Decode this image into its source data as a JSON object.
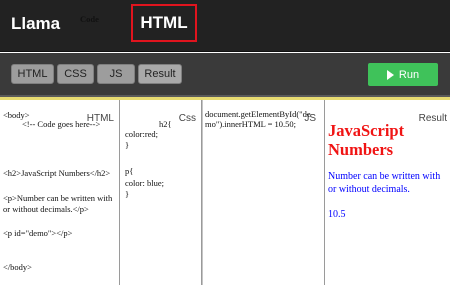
{
  "nav": {
    "items": [
      "Llama",
      "Code",
      "HTML"
    ],
    "active": "HTML"
  },
  "toolbar": {
    "tabs": [
      "HTML",
      "CSS",
      "JS",
      "Result"
    ],
    "run_label": "Run",
    "run_icon": "play-icon"
  },
  "panes": {
    "html": {
      "label": "HTML",
      "lines": [
        "<body>",
        "<!-- Code goes here-->",
        "<h2>JavaScript Numbers</h2>",
        "<p>Number can be written with",
        "or without decimals.</p>",
        "<p id=\"demo\"></p>",
        "</body>"
      ]
    },
    "css": {
      "label": "Css",
      "lines": [
        "h2{",
        "color:red;",
        "}",
        "p{",
        "color: blue;",
        "}"
      ]
    },
    "js": {
      "label": "JS",
      "lines": [
        "document.getElementById(\"de",
        "mo\").innerHTML = 10.50;"
      ]
    },
    "result": {
      "label": "Result",
      "heading": "JavaScript Numbers",
      "paragraph": "Number can be written with or without decimals.",
      "demo_output": "10.5"
    }
  },
  "colors": {
    "topbar": "#222222",
    "toolbar": "#3a3a3a",
    "active_outline": "#e0141e",
    "run_button": "#3fc25a",
    "pane_top_border": "#e7db71",
    "result_heading": "#f01414",
    "result_text": "#0000ff"
  }
}
